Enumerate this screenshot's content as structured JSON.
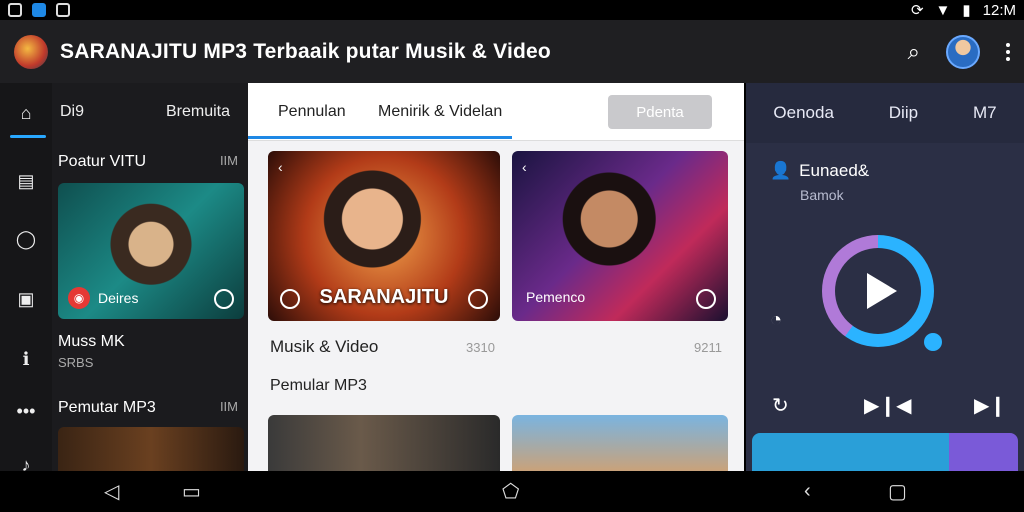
{
  "status_bar": {
    "time": "12:M",
    "icons": [
      "image-icon",
      "app-icon",
      "gallery-icon",
      "sync-icon",
      "wifi-icon",
      "battery-icon"
    ]
  },
  "app_bar": {
    "title": "SARANAJITU MP3 Terbaaik putar Musik & Video",
    "icons": [
      "app-logo",
      "search-icon",
      "avatar",
      "more-icon"
    ]
  },
  "left_panel": {
    "tabs": [
      "Di9",
      "Bremuita"
    ],
    "rail_icons": [
      "home-icon",
      "grid-icon",
      "chat-icon",
      "video-icon",
      "info-icon",
      "more-dots-icon",
      "music-icon"
    ],
    "section1": {
      "title": "Poatur VITU",
      "count": "IIM"
    },
    "card1": {
      "label": "Deires"
    },
    "list": {
      "title": "Muss MK",
      "sub": "SRBS"
    },
    "section2": {
      "title": "Pemutar MP3",
      "count": "IIM"
    }
  },
  "center_panel": {
    "tabs": [
      "Pennulan",
      "Menirik & Videlan"
    ],
    "button": "Pdenta",
    "cards": [
      {
        "title": "SARANAJITU"
      },
      {
        "title": "Pemenco"
      }
    ],
    "row1": {
      "label": "Musik & Video",
      "num_a": "3310",
      "num_b": "9211"
    },
    "row2": {
      "label": "Pemular MP3"
    }
  },
  "right_panel": {
    "tabs": [
      "Oenoda",
      "Diip",
      "M7"
    ],
    "track": {
      "title": "Eunaed&",
      "subtitle": "Bamok"
    },
    "progress": 0.6
  },
  "colors": {
    "accent": "#29a8ff",
    "player_bg": "#2b2f45",
    "ring_purple": "#b07ad8"
  }
}
